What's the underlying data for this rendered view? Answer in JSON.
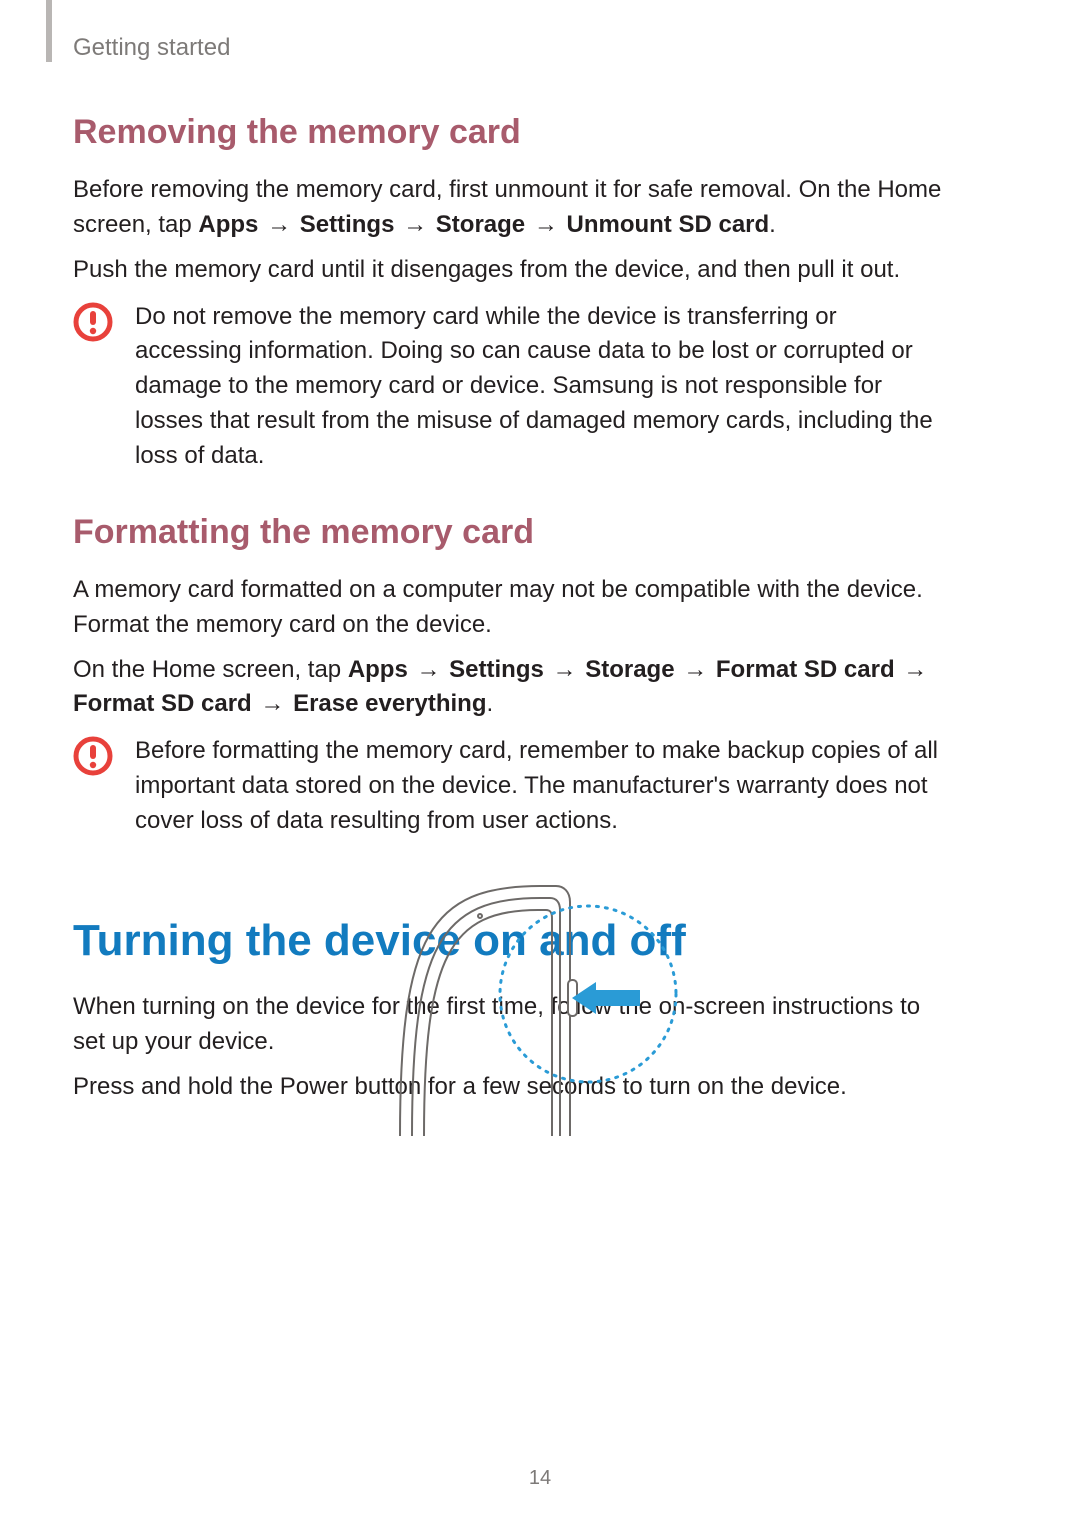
{
  "chapter": "Getting started",
  "page_number": "14",
  "arrow": "→",
  "sections": {
    "remove": {
      "title": "Removing the memory card",
      "p1": "Before removing the memory card, first unmount it for safe removal. On the Home screen, tap ",
      "path": [
        "Apps",
        "Settings",
        "Storage",
        "Unmount SD card"
      ],
      "p1_tail": ".",
      "p2": "Push the memory card until it disengages from the device, and then pull it out.",
      "caution": "Do not remove the memory card while the device is transferring or accessing information. Doing so can cause data to be lost or corrupted or damage to the memory card or device. Samsung is not responsible for losses that result from the misuse of damaged memory cards, including the loss of data."
    },
    "format": {
      "title": "Formatting the memory card",
      "p1": "A memory card formatted on a computer may not be compatible with the device. Format the memory card on the device.",
      "p2_lead": "On the Home screen, tap ",
      "path": [
        "Apps",
        "Settings",
        "Storage",
        "Format SD card",
        "Format SD card",
        "Erase everything"
      ],
      "p2_tail": ".",
      "caution": "Before formatting the memory card, remember to make backup copies of all important data stored on the device. The manufacturer's warranty does not cover loss of data resulting from user actions."
    },
    "power": {
      "title": "Turning the device on and off",
      "p1": "When turning on the device for the first time, follow the on-screen instructions to set up your device.",
      "p2": "Press and hold the Power button for a few seconds to turn on the device."
    }
  },
  "icons": {
    "caution": "caution-icon"
  }
}
